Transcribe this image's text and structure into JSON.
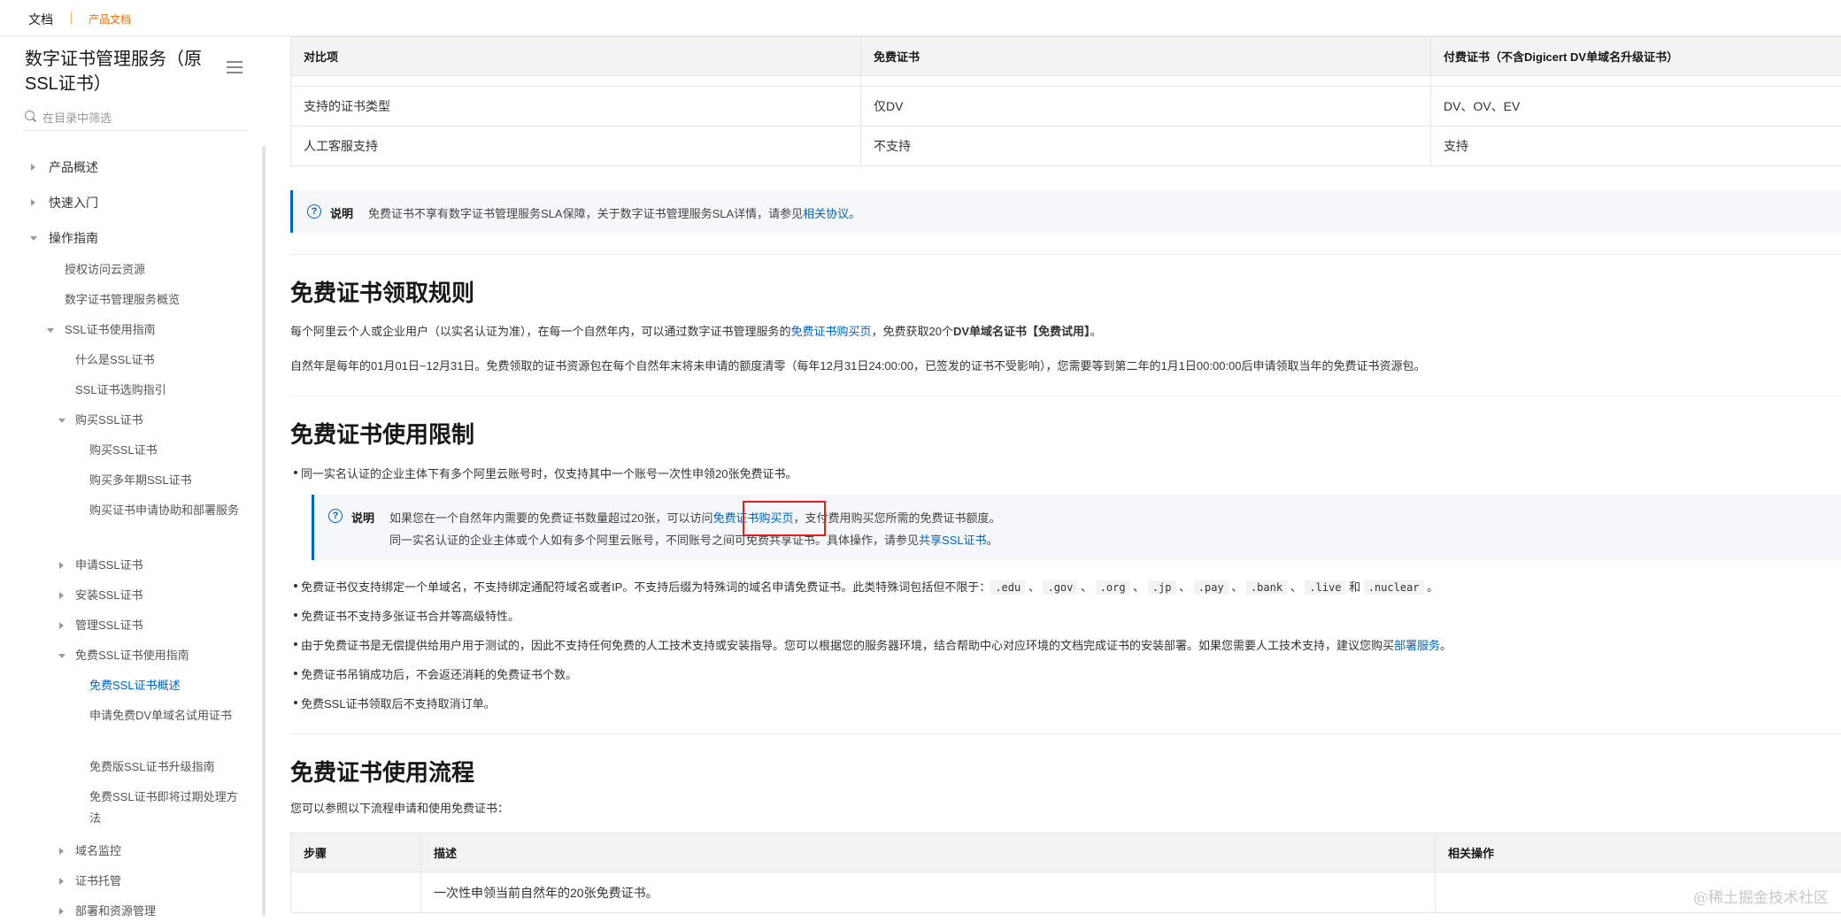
{
  "topbar": {
    "docs": "文档",
    "product_docs": "产品文档"
  },
  "sidebar": {
    "title": "数字证书管理服务（原SSL证书）",
    "filter_placeholder": "在目录中筛选",
    "items": [
      {
        "label": "产品概述"
      },
      {
        "label": "快速入门"
      },
      {
        "label": "操作指南"
      },
      {
        "label": "授权访问云资源"
      },
      {
        "label": "数字证书管理服务概览"
      },
      {
        "label": "SSL证书使用指南"
      },
      {
        "label": "什么是SSL证书"
      },
      {
        "label": "SSL证书选购指引"
      },
      {
        "label": "购买SSL证书"
      },
      {
        "label": "购买SSL证书"
      },
      {
        "label": "购买多年期SSL证书"
      },
      {
        "label": "购买证书申请协助和部署服务"
      },
      {
        "label": "申请SSL证书"
      },
      {
        "label": "安装SSL证书"
      },
      {
        "label": "管理SSL证书"
      },
      {
        "label": "免费SSL证书使用指南"
      },
      {
        "label": "免费SSL证书概述"
      },
      {
        "label": "申请免费DV单域名试用证书"
      },
      {
        "label": "免费版SSL证书升级指南"
      },
      {
        "label": "免费SSL证书即将过期处理方法"
      },
      {
        "label": "域名监控"
      },
      {
        "label": "证书托管"
      },
      {
        "label": "部署和资源管理"
      }
    ]
  },
  "compare_table": {
    "headers": [
      "对比项",
      "免费证书",
      "付费证书（不含Digicert DV单域名升级证书）"
    ],
    "rows": [
      [
        "支持的证书类型",
        "仅DV",
        "DV、OV、EV"
      ],
      [
        "人工客服支持",
        "不支持",
        "支持"
      ]
    ]
  },
  "note1": {
    "label": "说明",
    "text": "免费证书不享有数字证书管理服务SLA保障，关于数字证书管理服务SLA详情，请参见",
    "link": "相关协议",
    "end": "。"
  },
  "rules": {
    "title": "免费证书领取规则",
    "p1_a": "每个阿里云个人或企业用户（以实名认证为准），在每一个自然年内，可以通过数字证书管理服务的",
    "p1_link": "免费证书购买页",
    "p1_b": "，免费获取20个",
    "p1_bold": "DV单域名证书【免费试用】",
    "p1_c": "。",
    "p2": "自然年是每年的01月01日~12月31日。免费领取的证书资源包在每个自然年末将未申请的额度清零（每年12月31日24:00:00，已签发的证书不受影响），您需要等到第二年的1月1日00:00:00后申请领取当年的免费证书资源包。"
  },
  "limits": {
    "title": "免费证书使用限制",
    "b1": "同一实名认证的企业主体下有多个阿里云账号时，仅支持其中一个账号一次性申领20张免费证书。",
    "note": {
      "label": "说明",
      "l1_a": "如果您在一个自然年内需要的免费证书数量超过20张，可以访问",
      "l1_link": "免费证书购买页",
      "l1_b": "，支付费用购买您所需的免费证书额度。",
      "l2_a": "同一实名认证的企业主体或个人如有多个阿里云账号，不同账号之间可免费共享证书。具体操作，请参见",
      "l2_link": "共享SSL证书",
      "l2_b": "。"
    },
    "b2_a": "免费证书仅支持绑定一个单域名，不支持绑定通配符域名或者IP。不支持后缀为特殊词的域名申请免费证书。此类特殊词包括但不限于：",
    "b2_codes": [
      ".edu",
      ".gov",
      ".org",
      ".jp",
      ".pay",
      ".bank",
      ".live",
      ".nuclear"
    ],
    "b2_sep": "、",
    "b2_and": "和",
    "b2_end": "。",
    "b3": "免费证书不支持多张证书合并等高级特性。",
    "b4_a": "由于免费证书是无偿提供给用户用于测试的，因此不支持任何免费的人工技术支持或安装指导。您可以根据您的服务器环境，结合帮助中心对应环境的文档完成证书的安装部署。如果您需要人工技术支持，建议您购买",
    "b4_link": "部署服务",
    "b4_end": "。",
    "b5": "免费证书吊销成功后，不会返还消耗的免费证书个数。",
    "b6": "免费SSL证书领取后不支持取消订单。"
  },
  "flow": {
    "title": "免费证书使用流程",
    "intro": "您可以参照以下流程申请和使用免费证书：",
    "headers": [
      "步骤",
      "描述",
      "相关操作"
    ],
    "row1_desc": "一次性申领当前自然年的20张免费证书。"
  },
  "watermark": "@稀土掘金技术社区"
}
